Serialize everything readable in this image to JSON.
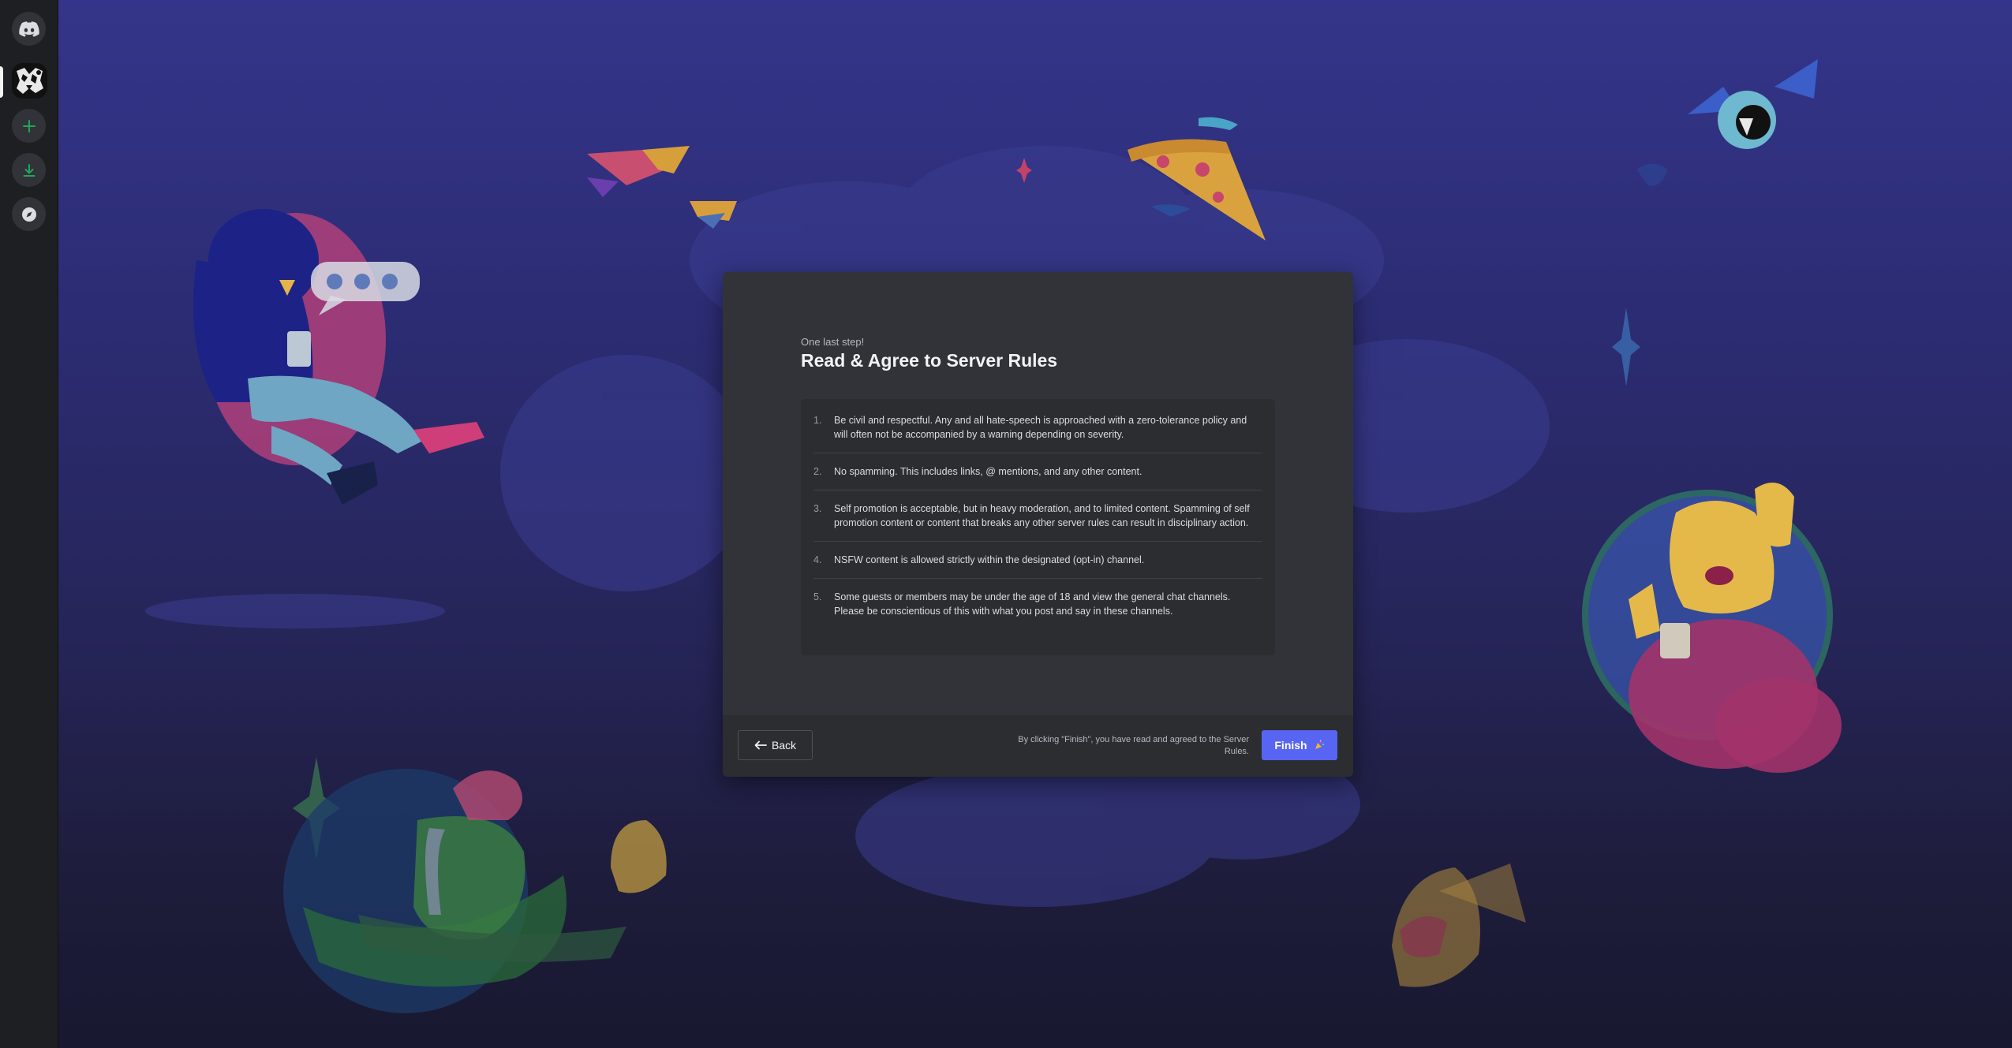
{
  "rail": {
    "home_icon": "discord-logo-icon",
    "server_name": "server-avatar",
    "add_icon": "plus-icon",
    "download_icon": "download-icon",
    "discover_icon": "compass-icon"
  },
  "onboarding": {
    "eyebrow": "One last step!",
    "title": "Read & Agree to Server Rules",
    "rules": [
      {
        "num": "1.",
        "text": "Be civil and respectful. Any and all hate-speech is approached with a zero-tolerance policy and will often not be accompanied by a warning depending on severity."
      },
      {
        "num": "2.",
        "text": "No spamming. This includes links, @ mentions, and any other content."
      },
      {
        "num": "3.",
        "text": "Self promotion is acceptable, but in heavy moderation, and to limited content. Spamming of self promotion content or content that breaks any other server rules can result in disciplinary action."
      },
      {
        "num": "4.",
        "text": "NSFW content is allowed strictly within the designated (opt-in) channel."
      },
      {
        "num": "5.",
        "text": "Some guests or members may be under the age of 18 and view the general chat channels. Please be conscientious of this with what you post and say in these channels."
      }
    ],
    "back_label": "Back",
    "footnote": "By clicking \"Finish\", you have read and agreed to the Server Rules.",
    "finish_label": "Finish"
  },
  "colors": {
    "accent": "#5865f2",
    "modal_bg": "#313338",
    "rules_bg": "#2b2d31",
    "rail_bg": "#1e1f22",
    "green": "#23a559"
  }
}
